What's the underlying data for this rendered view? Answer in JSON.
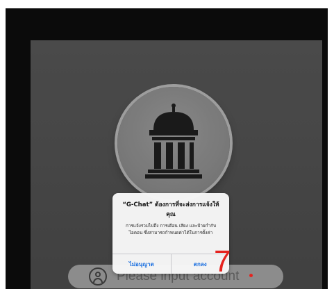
{
  "app_icon": "government-building-icon",
  "login": {
    "account_placeholder": "Please input account",
    "account_icon": "user-icon"
  },
  "alert": {
    "title": "“G-Chat” ต้องการที่จะส่งการแจ้งให้คุณ",
    "message": "การแจ้งรวมไปถึง การเตือน เสียง และป้ายกำกับไอคอน ซึ่งสามารถกำหนดค่าได้ในการตั้งค่า",
    "deny_label": "ไม่อนุญาต",
    "allow_label": "ตกลง"
  },
  "annotation": {
    "step_number": "7"
  },
  "colors": {
    "accent_blue": "#1a6fe0",
    "annotation_red": "#e5231e",
    "screen_bg": "#505050"
  }
}
